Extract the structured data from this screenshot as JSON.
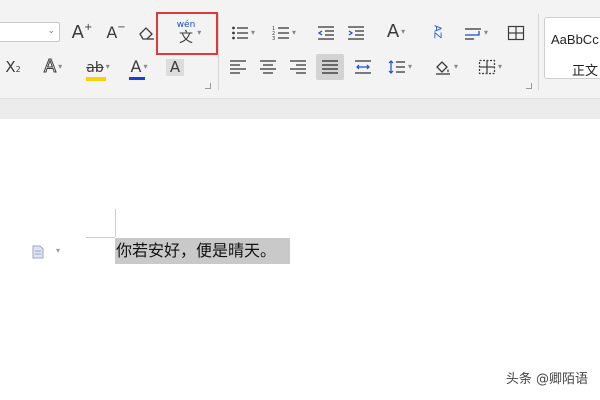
{
  "ribbon": {
    "phonetic_guide": {
      "pinyin": "wén",
      "char": "文"
    },
    "font_color_letter": "A",
    "char_shading_letter": "A",
    "grow_font_letter": "A",
    "shrink_font_letter": "A",
    "font_color_swatch": "#1a3fd1",
    "highlight_swatch": "#f5d400",
    "highlight_letters": "ab",
    "subscript_letter": "X",
    "subscript_mark": "2",
    "change_case_letter": "A",
    "sort_label": "AZ",
    "style_gallery": {
      "sample": "AaBbCc",
      "name": "正文"
    },
    "highlight_box_color": "#e23a3a"
  },
  "document": {
    "text": "你若安好，便是晴天。"
  },
  "watermark": "头条 @卿陌语"
}
